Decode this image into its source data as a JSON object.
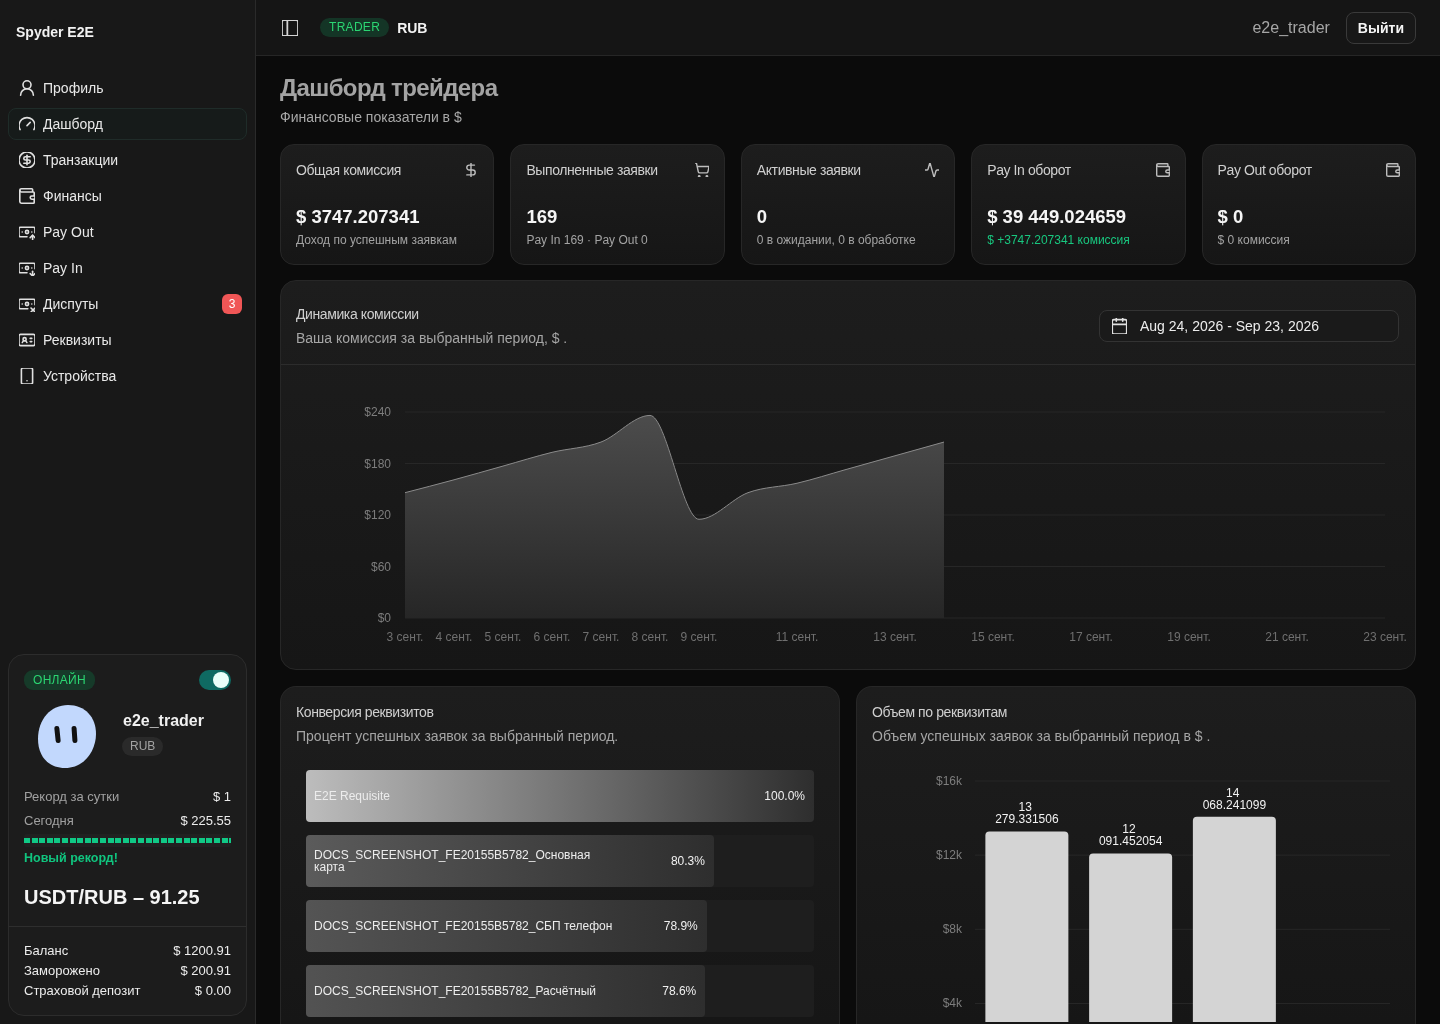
{
  "sidebar": {
    "brand": "Spyder E2E",
    "items": [
      {
        "label": "Профиль",
        "selected": false
      },
      {
        "label": "Дашборд",
        "selected": true
      },
      {
        "label": "Транзакции",
        "selected": false
      },
      {
        "label": "Финансы",
        "selected": false
      },
      {
        "label": "Pay Out",
        "selected": false
      },
      {
        "label": "Pay In",
        "selected": false
      },
      {
        "label": "Диспуты",
        "selected": false,
        "badge": "3"
      },
      {
        "label": "Реквизиты",
        "selected": false
      },
      {
        "label": "Устройства",
        "selected": false
      }
    ]
  },
  "profile_card": {
    "status": "ОНЛАЙН",
    "online": true,
    "username": "e2e_trader",
    "currency": "RUB",
    "records": [
      {
        "label": "Рекорд за сутки",
        "value": "$ 1"
      },
      {
        "label": "Сегодня",
        "value": "$ 225.55"
      }
    ],
    "progress": {
      "level": 1
    },
    "note": "Новый рекорд!",
    "rate": "USDT/RUB – 91.25",
    "balances": [
      {
        "label": "Баланс",
        "value": "$ 1200.91"
      },
      {
        "label": "Заморожено",
        "value": "$ 200.91"
      },
      {
        "label": "Страховой депозит",
        "value": "$ 0.00"
      }
    ]
  },
  "header": {
    "role": "TRADER",
    "currency": "RUB",
    "username": "e2e_trader",
    "logout": "Выйти"
  },
  "page": {
    "title": "Дашборд трейдера",
    "subtitle": "Финансовые показатели в $"
  },
  "stats": [
    {
      "title": "Общая комиссия",
      "value": "$ 3747.207341",
      "note": "Доход по успешным заявкам",
      "positive": false
    },
    {
      "title": "Выполненные заявки",
      "value": "169",
      "note": "Pay In 169 · Pay Out 0",
      "positive": false
    },
    {
      "title": "Активные заявки",
      "value": "0",
      "note": "0 в ожидании, 0 в обработке",
      "positive": false
    },
    {
      "title": "Pay In оборот",
      "value": "$ 39 449.024659",
      "note": "$ +3747.207341 комиссия",
      "positive": true
    },
    {
      "title": "Pay Out оборот",
      "value": "$ 0",
      "note": "$ 0 комиссия",
      "positive": false
    }
  ],
  "commission": {
    "title": "Динамика комиссии",
    "subtitle": "Ваша комиссия за выбранный период, $ .",
    "date_range": "Aug 24, 2026 - Sep 23, 2026",
    "chart_data": {
      "type": "area",
      "x": [
        3,
        4,
        5,
        6,
        7,
        8,
        9,
        10,
        11,
        12,
        13,
        14
      ],
      "values": [
        146,
        161,
        177,
        193,
        205,
        236,
        115,
        146,
        157,
        173,
        189,
        205
      ],
      "xlim": [
        3,
        23
      ],
      "ylim": [
        0,
        240
      ],
      "grid": true,
      "xticks": [
        {
          "value": 3,
          "label": "3 сент."
        },
        {
          "value": 4,
          "label": "4 сент."
        },
        {
          "value": 5,
          "label": "5 сент."
        },
        {
          "value": 6,
          "label": "6 сент."
        },
        {
          "value": 7,
          "label": "7 сент."
        },
        {
          "value": 8,
          "label": "8 сент."
        },
        {
          "value": 9,
          "label": "9 сент."
        },
        {
          "value": 11,
          "label": "11 сент."
        },
        {
          "value": 13,
          "label": "13 сент."
        },
        {
          "value": 15,
          "label": "15 сент."
        },
        {
          "value": 17,
          "label": "17 сент."
        },
        {
          "value": 19,
          "label": "19 сент."
        },
        {
          "value": 21,
          "label": "21 сент."
        },
        {
          "value": 23,
          "label": "23 сент."
        }
      ],
      "yticks": [
        {
          "value": 0,
          "label": "$0"
        },
        {
          "value": 60,
          "label": "$60"
        },
        {
          "value": 120,
          "label": "$120"
        },
        {
          "value": 180,
          "label": "$180"
        },
        {
          "value": 240,
          "label": "$240"
        }
      ]
    }
  },
  "conversion": {
    "title": "Конверсия реквизитов",
    "subtitle": "Процент успешных заявок за выбранный период.",
    "rows": [
      {
        "label": "E2E Requisite",
        "value": "100.0%",
        "level": 1
      },
      {
        "label": "DOCS_SCREENSHOT_FE20155B5782_Основная карта",
        "value": "80.3%",
        "level": 0.803
      },
      {
        "label": "DOCS_SCREENSHOT_FE20155B5782_СБП телефон",
        "value": "78.9%",
        "level": 0.789
      },
      {
        "label": "DOCS_SCREENSHOT_FE20155B5782_Расчётный",
        "value": "78.6%",
        "level": 0.786
      }
    ]
  },
  "volume": {
    "title": "Объем по реквизитам",
    "subtitle": "Объем успешных заявок за выбранный период в $ .",
    "chart_data": {
      "type": "bar",
      "values": [
        13279.331506,
        12091.452054,
        14068.241099,
        null
      ],
      "value_labels": [
        "13 279.331506",
        "12 091.452054",
        "14 068.241099",
        null
      ],
      "ylim": [
        3000,
        16000
      ],
      "grid": true,
      "yticks": [
        {
          "value": 4000,
          "label": "$4k"
        },
        {
          "value": 8000,
          "label": "$8k"
        },
        {
          "value": 12000,
          "label": "$12k"
        },
        {
          "value": 16000,
          "label": "$16k"
        }
      ]
    }
  }
}
